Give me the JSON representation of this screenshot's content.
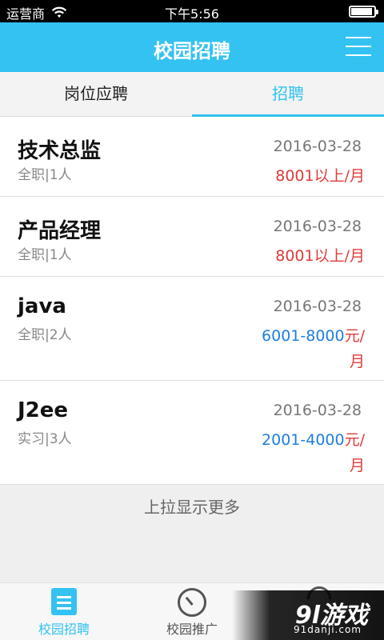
{
  "status_bar": {
    "carrier": "运营商",
    "time": "下午5:56"
  },
  "header": {
    "title": "校园招聘",
    "menu_icon": "hamburger-menu-icon"
  },
  "tabs": [
    {
      "label": "岗位应聘",
      "active": false
    },
    {
      "label": "招聘",
      "active": true
    }
  ],
  "jobs": [
    {
      "title": "技术总监",
      "meta": "全职|1人",
      "date": "2016-03-28",
      "salary": "8001以上/月",
      "salary_style": "red"
    },
    {
      "title": "产品经理",
      "meta": "全职|1人",
      "date": "2016-03-28",
      "salary": "8001以上/月",
      "salary_style": "red"
    },
    {
      "title": "java",
      "meta": "全职|2人",
      "date": "2016-03-28",
      "salary_range": "6001-8000",
      "salary_unit_1": "元/",
      "salary_unit_2": "月"
    },
    {
      "title": "J2ee",
      "meta": "实习|3人",
      "date": "2016-03-28",
      "salary_range": "2001-4000",
      "salary_unit_1": "元/",
      "salary_unit_2": "月"
    }
  ],
  "load_more": "上拉显示更多",
  "tabbar": [
    {
      "label": "校园招聘",
      "icon": "document-icon",
      "active": true
    },
    {
      "label": "校园推广",
      "icon": "compass-icon",
      "active": false
    },
    {
      "label": "",
      "icon": "user-icon",
      "active": false
    }
  ],
  "watermark": {
    "logo": "9l游戏",
    "url": "91danji.com"
  },
  "colors": {
    "accent": "#33c2f2",
    "salary_red": "#e23a3a",
    "salary_blue": "#1e7fe0"
  }
}
